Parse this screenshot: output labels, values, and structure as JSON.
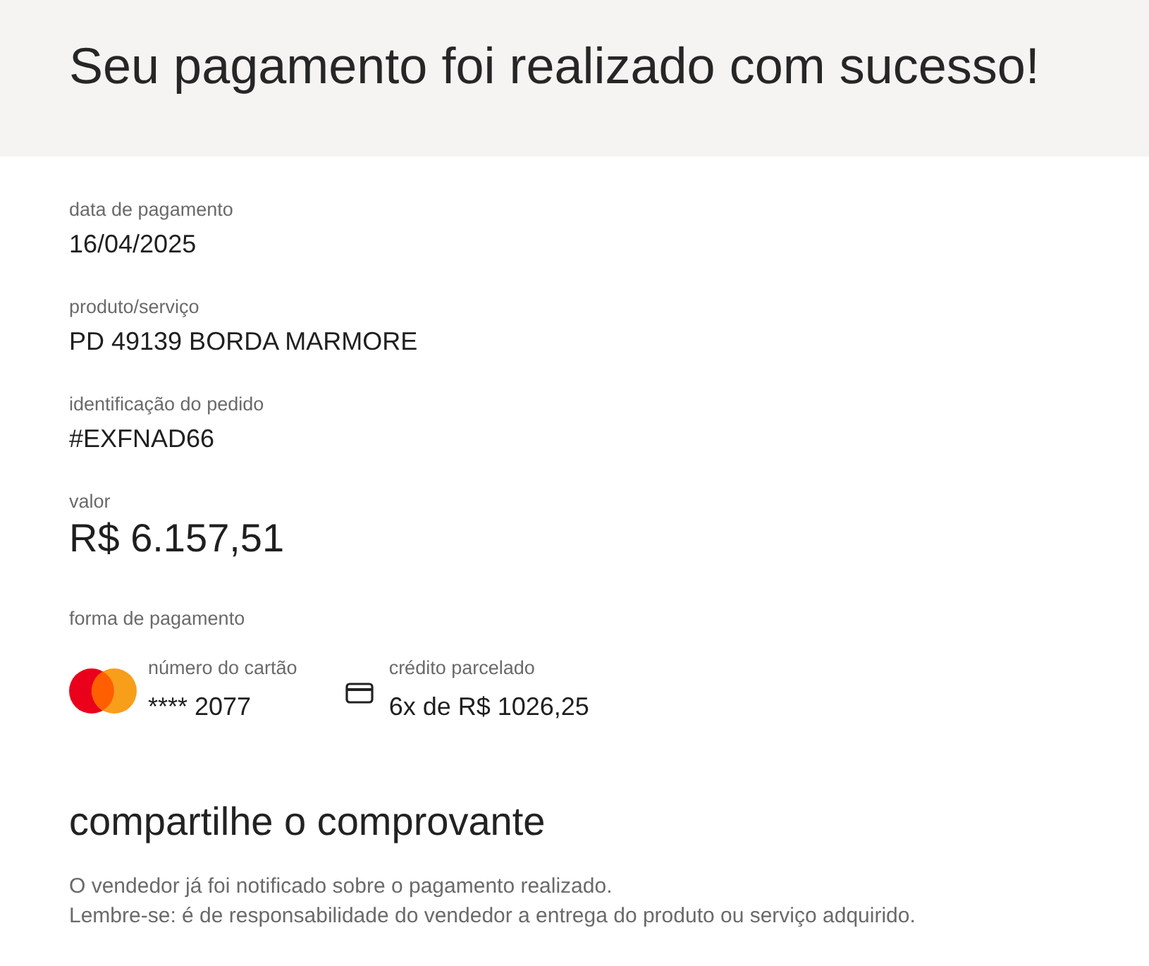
{
  "header": {
    "title": "Seu pagamento foi realizado com sucesso!"
  },
  "details": [
    {
      "kind": "text",
      "label": "data de pagamento",
      "value": "16/04/2025"
    },
    {
      "kind": "text",
      "label": "produto/serviço",
      "value": "PD 49139 BORDA MARMORE"
    },
    {
      "kind": "text",
      "label": "identificação do pedido",
      "value": "#EXFNAD66"
    },
    {
      "kind": "amount",
      "label": "valor",
      "value": "R$ 6.157,51"
    }
  ],
  "payment": {
    "label": "forma de pagamento",
    "methods": [
      {
        "kind": "brand",
        "label": "número do cartão",
        "value": "**** 2077"
      },
      {
        "kind": "card",
        "label": "crédito parcelado",
        "value": "6x de R$ 1026,25"
      }
    ]
  },
  "share": {
    "title": "compartilhe o comprovante",
    "lines": [
      "O vendedor já foi notificado sobre o pagamento realizado.",
      "Lembre-se: é de responsabilidade do vendedor a entrega do produto ou serviço adquirido."
    ]
  }
}
